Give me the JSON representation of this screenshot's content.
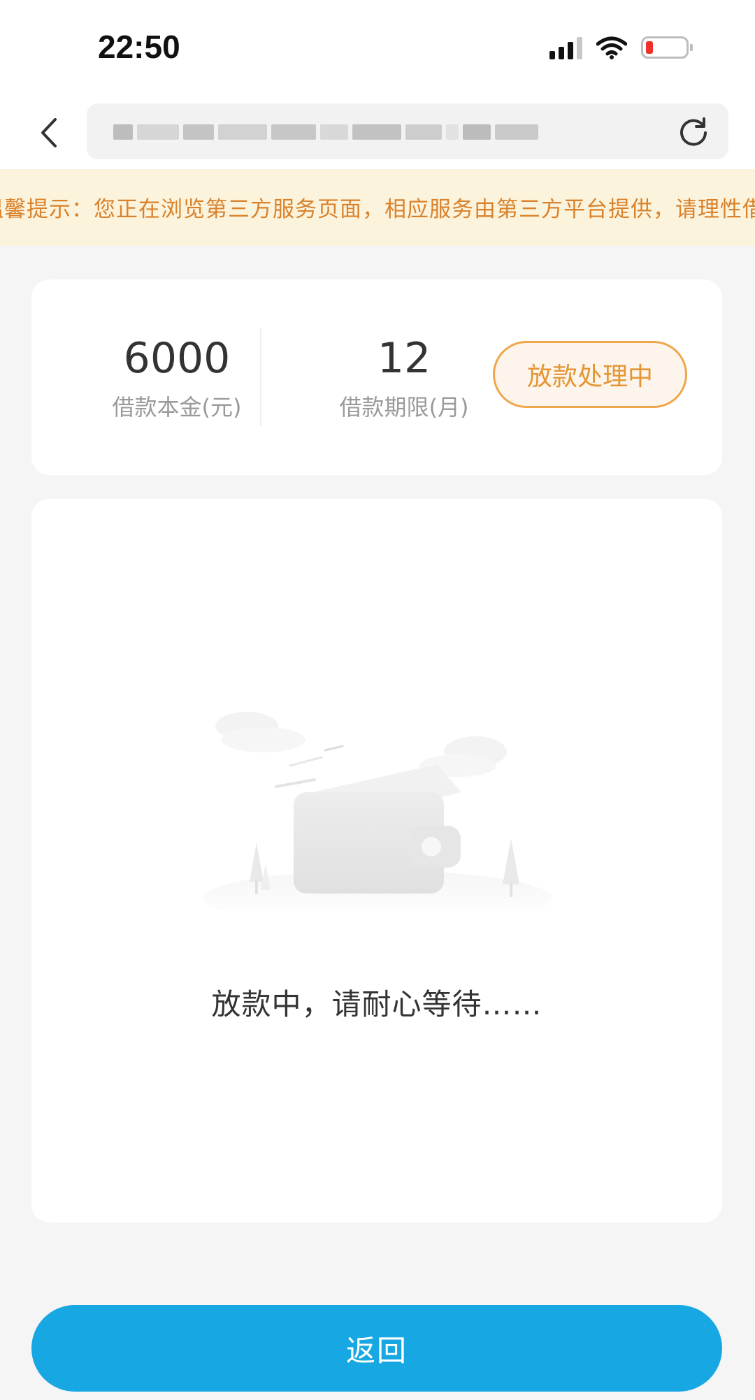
{
  "status_bar": {
    "time": "22:50",
    "signal_icon": "cellular-signal-icon",
    "wifi_icon": "wifi-icon",
    "battery_icon": "battery-low-icon",
    "battery_color": "#f0302a"
  },
  "nav": {
    "back_icon": "chevron-left-icon",
    "url_blurred": true,
    "refresh_icon": "refresh-icon"
  },
  "notice": {
    "text": "温馨提示：您正在浏览第三方服务页面，相应服务由第三方平台提供，请理性借贷",
    "text_color": "#d9822b",
    "background": "#fcf3dc"
  },
  "summary": {
    "principal_value": "6000",
    "principal_label": "借款本金(元)",
    "term_value": "12",
    "term_label": "借款期限(月)",
    "status_label": "放款处理中",
    "status_color": "#f0a64a"
  },
  "main": {
    "illustration_icon": "wallet-illustration",
    "waiting_text": "放款中，请耐心等待……"
  },
  "footer": {
    "return_label": "返回",
    "button_color": "#17a7e3"
  }
}
